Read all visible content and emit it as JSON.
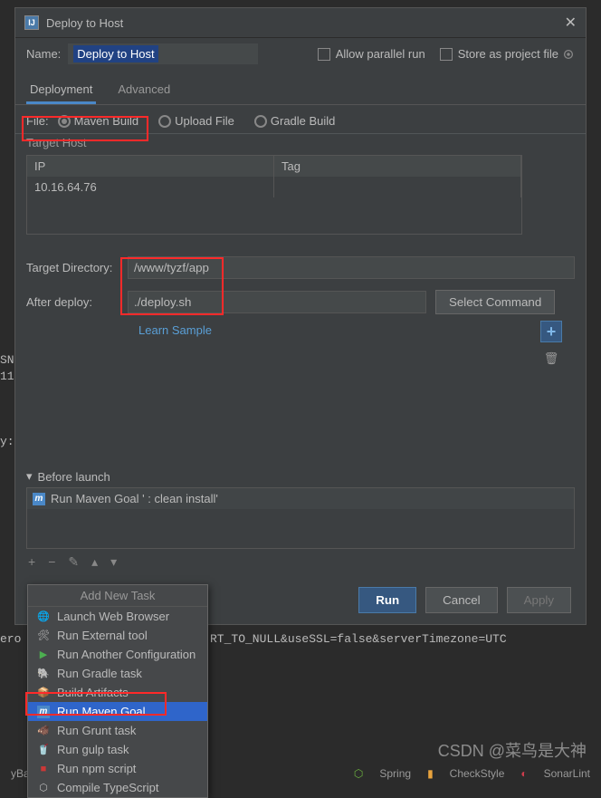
{
  "dialog": {
    "title": "Deploy to Host",
    "name_label": "Name:",
    "name_value": "Deploy to Host",
    "allow_parallel": "Allow parallel run",
    "store_project": "Store as project file"
  },
  "tabs": {
    "deployment": "Deployment",
    "advanced": "Advanced"
  },
  "file": {
    "label": "File:",
    "maven": "Maven Build",
    "upload": "Upload File",
    "gradle": "Gradle Build"
  },
  "host": {
    "section": "Target Host",
    "ip_header": "IP",
    "tag_header": "Tag",
    "ip_value": "10.16.64.76",
    "tag_value": ""
  },
  "form": {
    "target_dir_label": "Target Directory:",
    "target_dir_value": "/www/tyzf/app",
    "after_deploy_label": "After deploy:",
    "after_deploy_value": "./deploy.sh",
    "select_command": "Select Command",
    "learn_sample": "Learn Sample"
  },
  "before_launch": {
    "title": "Before launch",
    "item": "Run Maven Goal '                           : clean install'",
    "add_title": "Add New Task"
  },
  "menu": {
    "items": [
      {
        "label": "Launch Web Browser",
        "icon": "🌐"
      },
      {
        "label": "Run External tool",
        "icon": "🛠"
      },
      {
        "label": "Run Another Configuration",
        "icon": "▶"
      },
      {
        "label": "Run Gradle task",
        "icon": "🐘"
      },
      {
        "label": "Build Artifacts",
        "icon": "📦"
      },
      {
        "label": "Run Maven Goal",
        "icon": "m"
      },
      {
        "label": "Run Grunt task",
        "icon": "🐗"
      },
      {
        "label": "Run gulp task",
        "icon": "🥤"
      },
      {
        "label": "Run npm script",
        "icon": "■"
      },
      {
        "label": "Compile TypeScript",
        "icon": "⬡"
      }
    ]
  },
  "buttons": {
    "run": "Run",
    "cancel": "Cancel",
    "apply": "Apply"
  },
  "bg": {
    "text1": "SN",
    "text2": "11",
    "text3": "y:",
    "text4": "ero",
    "conn": "RT_TO_NULL&useSSL=false&serverTimezone=UTC"
  },
  "status": {
    "batis": "yBatis",
    "spring": "Spring",
    "checkstyle": "CheckStyle",
    "sonarlint": "SonarLint"
  },
  "watermark": "CSDN @菜鸟是大神"
}
